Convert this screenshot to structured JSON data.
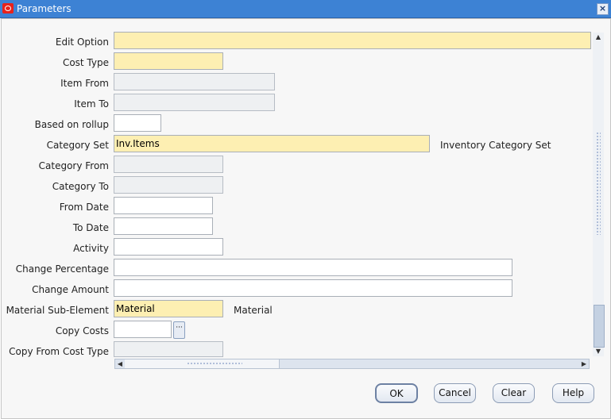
{
  "window": {
    "title": "Parameters",
    "close_glyph": "×"
  },
  "fields": [
    {
      "label": "Edit Option",
      "value": ""
    },
    {
      "label": "Cost Type",
      "value": ""
    },
    {
      "label": "Item From",
      "value": ""
    },
    {
      "label": "Item To",
      "value": ""
    },
    {
      "label": "Based on rollup",
      "value": ""
    },
    {
      "label": "Category Set",
      "value": "Inv.Items",
      "description": "Inventory Category Set"
    },
    {
      "label": "Category From",
      "value": ""
    },
    {
      "label": "Category To",
      "value": ""
    },
    {
      "label": "From Date",
      "value": ""
    },
    {
      "label": "To Date",
      "value": ""
    },
    {
      "label": "Activity",
      "value": ""
    },
    {
      "label": "Change Percentage",
      "value": ""
    },
    {
      "label": "Change Amount",
      "value": ""
    },
    {
      "label": "Material Sub-Element",
      "value": "Material",
      "description": "Material"
    },
    {
      "label": "Copy Costs",
      "value": "",
      "lov_glyph": "···"
    },
    {
      "label": "Copy From Cost Type",
      "value": ""
    }
  ],
  "scroll": {
    "up": "▲",
    "down": "▼",
    "left": "◀",
    "right": "▶"
  },
  "buttons": {
    "ok": "OK",
    "cancel": "Cancel",
    "clear": "Clear",
    "help": "Help"
  },
  "colors": {
    "required": "#fdefb2",
    "title_bar": "#3d82d4",
    "read_only": "#eef0f2"
  }
}
